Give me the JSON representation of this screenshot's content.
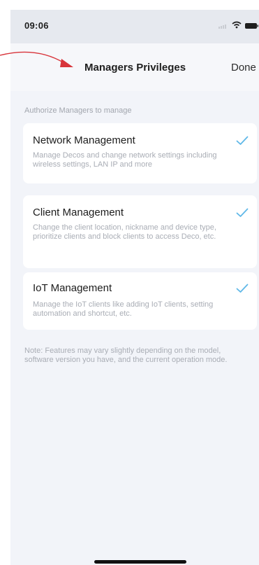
{
  "status_bar": {
    "time": "09:06"
  },
  "nav": {
    "title": "Managers Privileges",
    "done_label": "Done"
  },
  "section": {
    "header": "Authorize Managers to manage"
  },
  "permissions": [
    {
      "title": "Network Management",
      "description": "Manage Decos and change network settings including wireless settings, LAN IP and more",
      "checked": true
    },
    {
      "title": "Client Management",
      "description": "Change the client location, nickname and device type, prioritize clients and block clients to access Deco, etc.",
      "checked": true
    },
    {
      "title": "IoT Management",
      "description": "Manage the IoT clients like adding IoT clients, setting automation and shortcut, etc.",
      "checked": true
    }
  ],
  "note": "Note: Features may vary slightly depending on the model, software version you have, and the current operation mode.",
  "colors": {
    "check": "#5fb8e8",
    "annotation_arrow": "#d8343a",
    "background": "#f2f4f9"
  },
  "icons": {
    "wifi": "wifi-icon",
    "battery": "battery-icon",
    "check": "checkmark-icon"
  }
}
